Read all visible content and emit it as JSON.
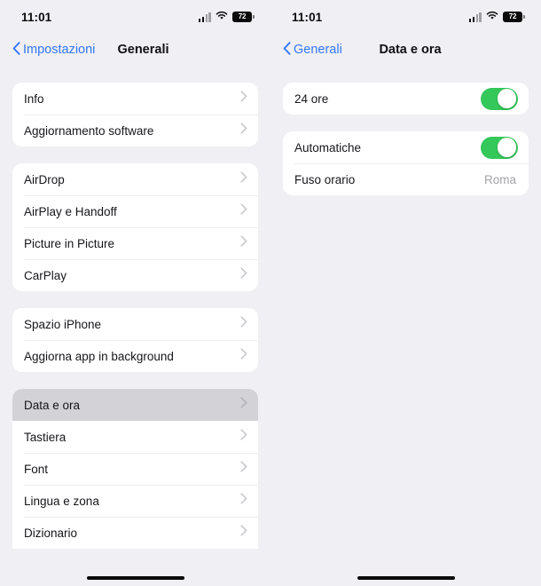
{
  "screens": [
    {
      "id": "generali",
      "status_bar": {
        "time": "11:01",
        "signal_icon": "cellular-signal-icon",
        "wifi_icon": "wifi-icon",
        "battery_icon": "battery-icon",
        "battery_percent": "72"
      },
      "nav": {
        "back_label": "Impostazioni",
        "back_icon": "chevron-left-icon",
        "title": "Generali"
      },
      "groups": [
        {
          "rows": [
            {
              "label": "Info",
              "accessory": "chevron"
            },
            {
              "label": "Aggiornamento software",
              "accessory": "chevron"
            }
          ]
        },
        {
          "rows": [
            {
              "label": "AirDrop",
              "accessory": "chevron"
            },
            {
              "label": "AirPlay e Handoff",
              "accessory": "chevron"
            },
            {
              "label": "Picture in Picture",
              "accessory": "chevron"
            },
            {
              "label": "CarPlay",
              "accessory": "chevron"
            }
          ]
        },
        {
          "rows": [
            {
              "label": "Spazio iPhone",
              "accessory": "chevron"
            },
            {
              "label": "Aggiorna app in background",
              "accessory": "chevron"
            }
          ]
        },
        {
          "clipped": true,
          "rows": [
            {
              "label": "Data e ora",
              "accessory": "chevron",
              "selected": true
            },
            {
              "label": "Tastiera",
              "accessory": "chevron"
            },
            {
              "label": "Font",
              "accessory": "chevron"
            },
            {
              "label": "Lingua e zona",
              "accessory": "chevron"
            },
            {
              "label": "Dizionario",
              "accessory": "chevron"
            }
          ]
        }
      ]
    },
    {
      "id": "data-e-ora",
      "status_bar": {
        "time": "11:01",
        "signal_icon": "cellular-signal-icon",
        "wifi_icon": "wifi-icon",
        "battery_icon": "battery-icon",
        "battery_percent": "72"
      },
      "nav": {
        "back_label": "Generali",
        "back_icon": "chevron-left-icon",
        "title": "Data e ora"
      },
      "groups": [
        {
          "rows": [
            {
              "label": "24 ore",
              "accessory": "toggle",
              "toggle_on": true
            }
          ]
        },
        {
          "rows": [
            {
              "label": "Automatiche",
              "accessory": "toggle",
              "toggle_on": true
            },
            {
              "label": "Fuso orario",
              "accessory": "value",
              "value": "Roma"
            }
          ]
        }
      ]
    }
  ],
  "colors": {
    "background": "#EFEFF4",
    "card": "#FFFFFF",
    "accent_blue": "#3478F6",
    "toggle_on": "#34C759",
    "selected_row": "#D2D2D7",
    "value_text": "#A3A3A8",
    "separator": "#EDEDF0"
  },
  "home_indicator": "home-indicator"
}
